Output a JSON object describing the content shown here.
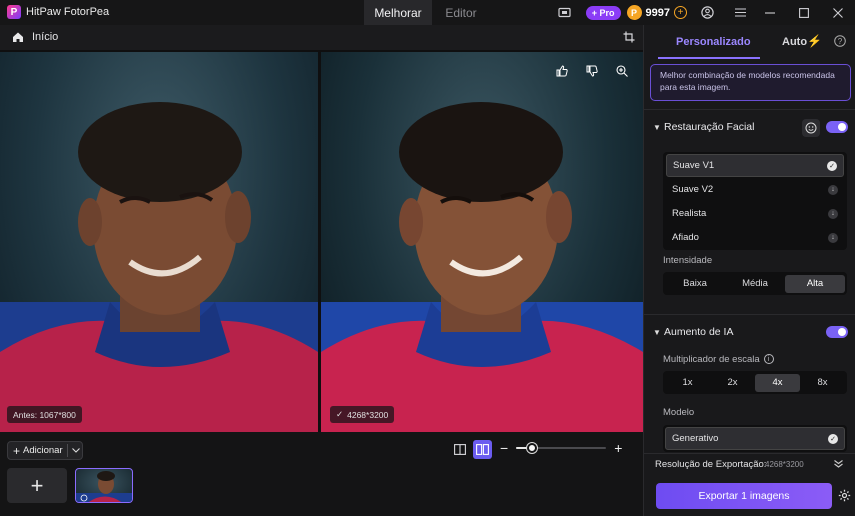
{
  "app": {
    "title": "HitPaw FotorPea"
  },
  "main_tabs": [
    {
      "label": "Melhorar",
      "active": true
    },
    {
      "label": "Editor",
      "active": false
    }
  ],
  "titlebar": {
    "pro_label": "+ Pro",
    "credits": "9997",
    "icons": [
      "screen-record-icon",
      "account-icon",
      "menu-icon",
      "minimize-icon",
      "maximize-icon",
      "close-icon"
    ]
  },
  "subbar": {
    "home_label": "Início"
  },
  "preview": {
    "before_label": "Antes: 1067*800",
    "after_label": "4268*3200"
  },
  "bottom": {
    "add_label": "Adicionar",
    "add_big": "+",
    "zoom_percent": 0.18
  },
  "sidebar": {
    "tabs": [
      {
        "label": "Personalizado",
        "active": true
      },
      {
        "label": "Auto",
        "active": false
      }
    ],
    "info_text": "Melhor combinação de modelos recomendada para esta imagem.",
    "face": {
      "title": "Restauração Facial",
      "enabled": true,
      "models": [
        {
          "label": "Suave V1",
          "state": "selected"
        },
        {
          "label": "Suave V2",
          "state": "download"
        },
        {
          "label": "Realista",
          "state": "download"
        },
        {
          "label": "Afiado",
          "state": "download"
        }
      ],
      "intensity_label": "Intensidade",
      "intensity_options": [
        "Baixa",
        "Média",
        "Alta"
      ],
      "intensity_selected": "Alta"
    },
    "upscale": {
      "title": "Aumento de IA",
      "enabled": true,
      "scale_label": "Multiplicador de escala",
      "scale_options": [
        "1x",
        "2x",
        "4x",
        "8x"
      ],
      "scale_selected": "4x",
      "model_label": "Modelo",
      "model_value": "Generativo"
    },
    "export": {
      "resolution_label": "Resolução de Exportação:",
      "resolution_value": "4268*3200",
      "button_label": "Exportar 1 imagens"
    }
  },
  "colors": {
    "accent": "#7a62f5",
    "background": "#0f0f10",
    "panel": "#19191b"
  }
}
